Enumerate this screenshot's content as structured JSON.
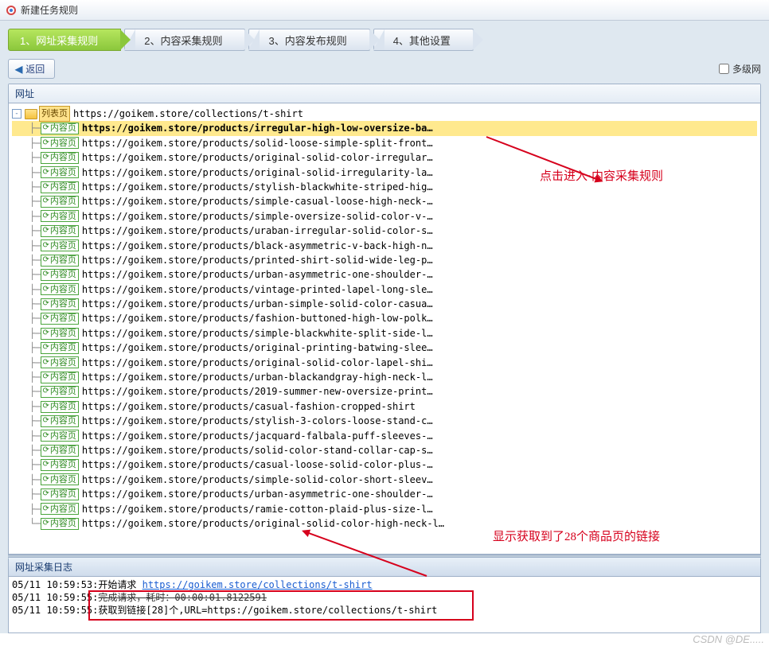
{
  "window_title": "新建任务规则",
  "tabs": [
    {
      "label": "1、网址采集规则",
      "active": true
    },
    {
      "label": "2、内容采集规则",
      "active": false
    },
    {
      "label": "3、内容发布规则",
      "active": false
    },
    {
      "label": "4、其他设置",
      "active": false
    }
  ],
  "back_button": "返回",
  "multi_level_label": "多级网",
  "panel_title": "网址",
  "tree_root_badge": "列表页",
  "tree_root_url": "https://goikem.store/collections/t-shirt",
  "content_badge_label": "内容页",
  "url_list": [
    "https://goikem.store/products/irregular-high-low-oversize-ba…",
    "https://goikem.store/products/solid-loose-simple-split-front…",
    "https://goikem.store/products/original-solid-color-irregular…",
    "https://goikem.store/products/original-solid-irregularity-la…",
    "https://goikem.store/products/stylish-blackwhite-striped-hig…",
    "https://goikem.store/products/simple-casual-loose-high-neck-…",
    "https://goikem.store/products/simple-oversize-solid-color-v-…",
    "https://goikem.store/products/uraban-irregular-solid-color-s…",
    "https://goikem.store/products/black-asymmetric-v-back-high-n…",
    "https://goikem.store/products/printed-shirt-solid-wide-leg-p…",
    "https://goikem.store/products/urban-asymmetric-one-shoulder-…",
    "https://goikem.store/products/vintage-printed-lapel-long-sle…",
    "https://goikem.store/products/urban-simple-solid-color-casua…",
    "https://goikem.store/products/fashion-buttoned-high-low-polk…",
    "https://goikem.store/products/simple-blackwhite-split-side-l…",
    "https://goikem.store/products/original-printing-batwing-slee…",
    "https://goikem.store/products/original-solid-color-lapel-shi…",
    "https://goikem.store/products/urban-blackandgray-high-neck-l…",
    "https://goikem.store/products/2019-summer-new-oversize-print…",
    "https://goikem.store/products/casual-fashion-cropped-shirt",
    "https://goikem.store/products/stylish-3-colors-loose-stand-c…",
    "https://goikem.store/products/jacquard-falbala-puff-sleeves-…",
    "https://goikem.store/products/solid-color-stand-collar-cap-s…",
    "https://goikem.store/products/casual-loose-solid-color-plus-…",
    "https://goikem.store/products/simple-solid-color-short-sleev…",
    "https://goikem.store/products/urban-asymmetric-one-shoulder-…",
    "https://goikem.store/products/ramie-cotton-plaid-plus-size-l…",
    "https://goikem.store/products/original-solid-color-high-neck-l…"
  ],
  "log_panel_title": "网址采集日志",
  "logs": {
    "l1_time": "05/11 10:59:53:",
    "l1_text": "开始请求 ",
    "l1_link": "https://goikem.store/collections/t-shirt",
    "l2_time": "05/11 10:59:55:",
    "l2_text": "完成请求，耗时：00:00:01.8122591",
    "l3_time": "05/11 10:59:55",
    "l3_text": ":获取到链接[28]个,URL=https://goikem.store/collections/t-shirt"
  },
  "annotations": {
    "a1": "点击进入·内容采集规则",
    "a2": "显示获取到了28个商品页的链接"
  },
  "watermark": "CSDN @DE....."
}
